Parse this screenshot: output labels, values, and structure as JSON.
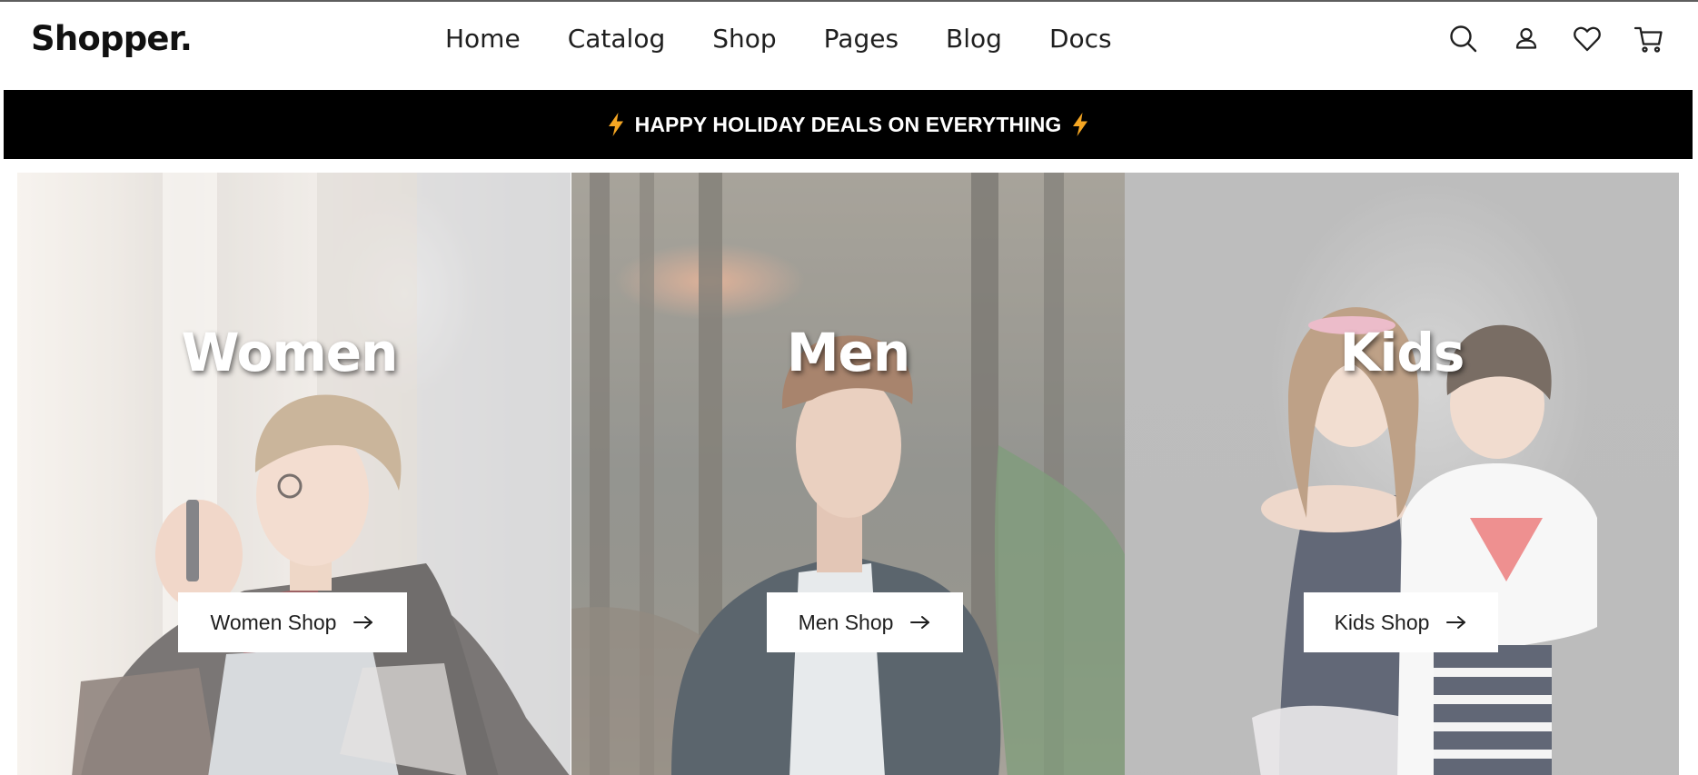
{
  "brand": {
    "name": "Shopper."
  },
  "nav": {
    "items": [
      {
        "label": "Home"
      },
      {
        "label": "Catalog"
      },
      {
        "label": "Shop"
      },
      {
        "label": "Pages"
      },
      {
        "label": "Blog"
      },
      {
        "label": "Docs"
      }
    ]
  },
  "header_icons": [
    "search-icon",
    "user-icon",
    "heart-icon",
    "cart-icon"
  ],
  "promo": {
    "text": "HAPPY HOLIDAY DEALS ON EVERYTHING",
    "icon": "lightning-bolt-icon",
    "icon_color": "#f5a623",
    "background": "#000000"
  },
  "categories": [
    {
      "title": "Women",
      "button_label": "Women Shop",
      "button_icon": "arrow-right-icon"
    },
    {
      "title": "Men",
      "button_label": "Men Shop",
      "button_icon": "arrow-right-icon"
    },
    {
      "title": "Kids",
      "button_label": "Kids Shop",
      "button_icon": "arrow-right-icon"
    }
  ]
}
